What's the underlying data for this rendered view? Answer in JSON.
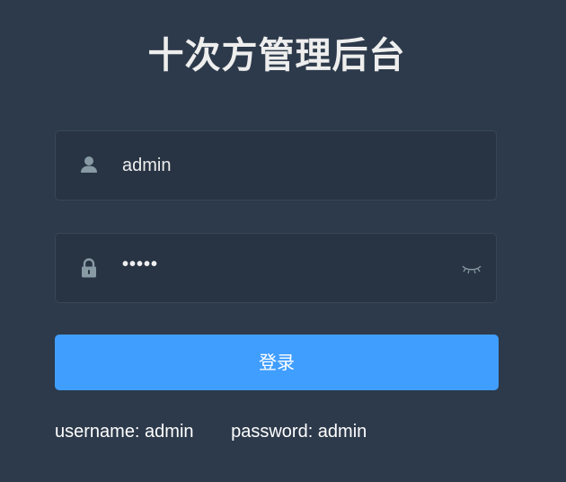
{
  "page": {
    "title": "十次方管理后台"
  },
  "form": {
    "username": {
      "value": "admin",
      "icon": "user-icon"
    },
    "password": {
      "value": "•••••",
      "icon": "lock-icon",
      "toggle_icon": "eye-closed-icon"
    },
    "login_label": "登录"
  },
  "tips": {
    "username": "username: admin",
    "password": "password: admin"
  },
  "colors": {
    "background": "#2d3a4b",
    "field_background": "#283443",
    "accent": "#409eff",
    "icon": "#889aa4"
  }
}
